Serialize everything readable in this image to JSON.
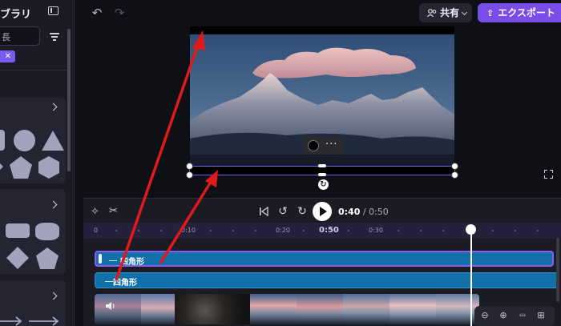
{
  "library": {
    "title": "ブラリ",
    "search_value": "長",
    "filter_chip": "✕"
  },
  "topbar": {
    "undo_icon": "undo-icon",
    "redo_icon": "redo-icon",
    "share_label": "共有",
    "export_label": "エクスポート"
  },
  "timeline": {
    "time_current": "0:40",
    "time_total": " / 0:50",
    "ruler_labels": [
      "0",
      "0:10",
      "0:20",
      "0:30"
    ],
    "ruler_current": "0:50",
    "clips": {
      "shape_top": "四角形",
      "shape_bottom": "四角形"
    }
  },
  "colors": {
    "accent": "#7b4de8",
    "clip_blue": "#1170a8",
    "annotation_red": "#e01a1a"
  }
}
